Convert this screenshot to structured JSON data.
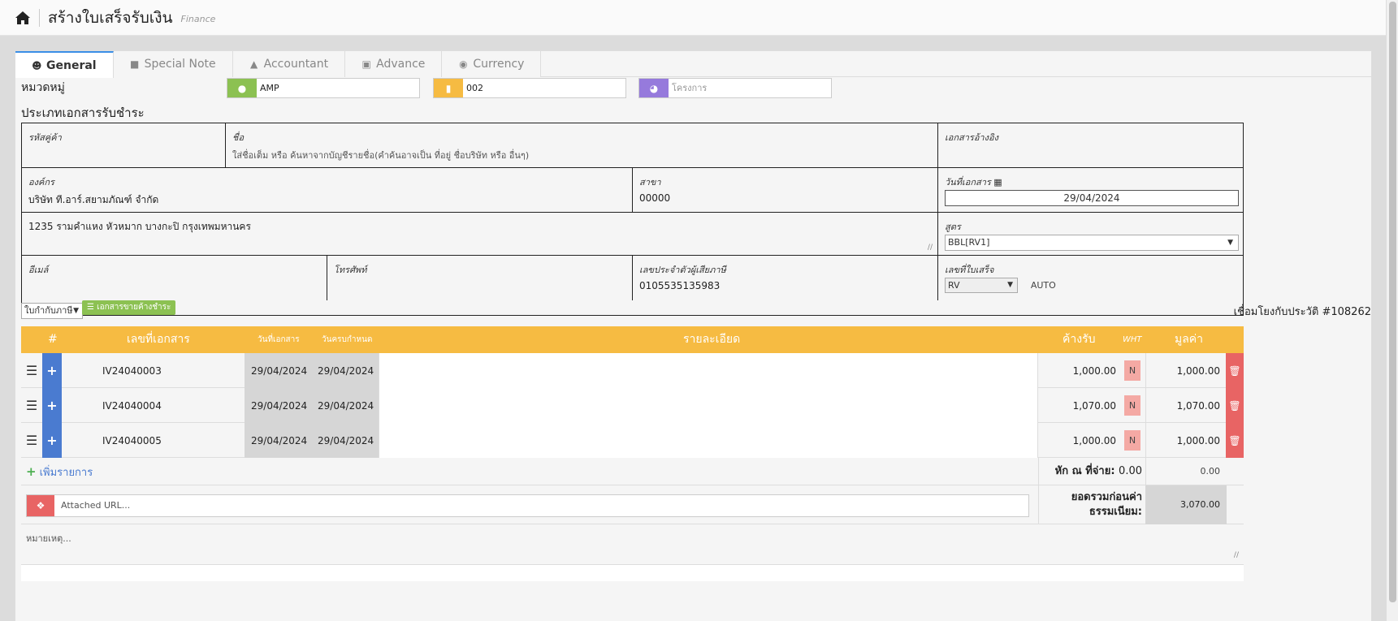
{
  "header": {
    "title": "สร้างใบเสร็จรับเงิน",
    "subtitle": "Finance",
    "home_icon": "home-icon"
  },
  "tabs": [
    {
      "label": "General",
      "icon": "user-icon",
      "active": true
    },
    {
      "label": "Special Note",
      "icon": "note-icon",
      "active": false
    },
    {
      "label": "Accountant",
      "icon": "graduation-cap-icon",
      "active": false
    },
    {
      "label": "Advance",
      "icon": "info-icon",
      "active": false
    },
    {
      "label": "Currency",
      "icon": "globe-icon",
      "active": false
    }
  ],
  "category": {
    "label": "หมวดหมู่",
    "contact_value": "AMP",
    "doc_value": "002",
    "project_placeholder": "โครงการ",
    "colors": {
      "contact": "#8cc152",
      "doc": "#f6bb42",
      "project": "#967adc"
    }
  },
  "doc_type_label": "ประเภทเอกสารรับชำระ",
  "customer": {
    "code_label": "รหัสคู่ค้า",
    "code_value": "",
    "name_label": "ชื่อ",
    "name_placeholder": "ใส่ชื่อเต็ม หรือ ค้นหาจากบัญชีรายชื่อ(คำค้นอาจเป็น ที่อยู่ ชื่อบริษัท หรือ อื่นๆ)",
    "ref_label": "เอกสารอ้างอิง",
    "ref_value": "",
    "org_label": "องค์กร",
    "org_value": "บริษัท ที.อาร์.สยามภัณฑ์ จำกัด",
    "branch_label": "สาขา",
    "branch_value": "00000",
    "date_label": "วันที่เอกสาร",
    "date_value": "29/04/2024",
    "address_value": "1235 รามคำแหง หัวหมาก บางกะปิ กรุงเทพมหานคร",
    "formula_label": "สูตร",
    "formula_value": "BBL[RV1]",
    "email_label": "อีเมล์",
    "phone_label": "โทรศัพท์",
    "tax_label": "เลขประจำตัวผู้เสียภาษี",
    "tax_value": "0105535135983",
    "receipt_label": "เลขที่ใบเสร็จ",
    "receipt_prefix": "RV",
    "receipt_auto": "AUTO"
  },
  "toolbar": {
    "doc_select": "ใบกำกับภาษี",
    "outstanding_button": "เอกสารขายค้างชำระ",
    "history_link": "เชื่อมโยงกับประวัติ #108262"
  },
  "grid": {
    "headers": {
      "num": "#",
      "doc_no": "เลขที่เอกสาร",
      "doc_date": "วันที่เอกสาร",
      "due_date": "วันครบกำหนด",
      "detail": "รายละเอียด",
      "owed": "ค้างรับ",
      "wht": "WHT",
      "value": "มูลค่า"
    },
    "rows": [
      {
        "doc_no": "IV24040003",
        "doc_date": "29/04/2024",
        "due_date": "29/04/2024",
        "owed": "1,000.00",
        "wht": "N",
        "value": "1,000.00"
      },
      {
        "doc_no": "IV24040004",
        "doc_date": "29/04/2024",
        "due_date": "29/04/2024",
        "owed": "1,070.00",
        "wht": "N",
        "value": "1,070.00"
      },
      {
        "doc_no": "IV24040005",
        "doc_date": "29/04/2024",
        "due_date": "29/04/2024",
        "owed": "1,000.00",
        "wht": "N",
        "value": "1,000.00"
      }
    ],
    "add_item": "เพิ่มรายการ",
    "wht_label": "หัก ณ ที่จ่าย:",
    "wht_total": "0.00",
    "wht_amount": "0.00",
    "url_placeholder": "Attached URL...",
    "subtotal_label_1": "ยอดรวมก่อนค่า",
    "subtotal_label_2": "ธรรมเนียม:",
    "subtotal_value": "3,070.00",
    "remark_placeholder": "หมายเหตุ..."
  }
}
